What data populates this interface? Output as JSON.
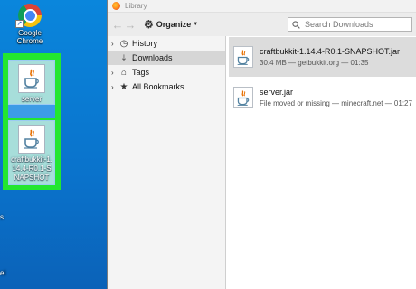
{
  "desktop": {
    "chrome_label": "Google Chrome",
    "icons": [
      {
        "label": "server"
      },
      {
        "label": "craftbukkit-1.14.4-R0.1-SNAPSHOT"
      }
    ],
    "highlight_color": "#23e630",
    "edge_text_1": "s",
    "edge_text_2": "el"
  },
  "window": {
    "title": "Library",
    "toolbar": {
      "back_icon": "back-arrow-icon",
      "forward_icon": "forward-arrow-icon",
      "organize_label": "Organize",
      "search_placeholder": "Search Downloads"
    },
    "sidebar": {
      "items": [
        {
          "label": "History",
          "icon": "clock-icon",
          "expandable": true
        },
        {
          "label": "Downloads",
          "icon": "download-icon",
          "expandable": false,
          "active": true
        },
        {
          "label": "Tags",
          "icon": "tag-icon",
          "expandable": true
        },
        {
          "label": "All Bookmarks",
          "icon": "star-icon",
          "expandable": true
        }
      ]
    },
    "downloads": [
      {
        "name": "craftbukkit-1.14.4-R0.1-SNAPSHOT.jar",
        "status": "30.4 MB — getbukkit.org — 01:35",
        "selected": true
      },
      {
        "name": "server.jar",
        "status": "File moved or missing — minecraft.net — 01:27",
        "selected": false
      }
    ]
  }
}
